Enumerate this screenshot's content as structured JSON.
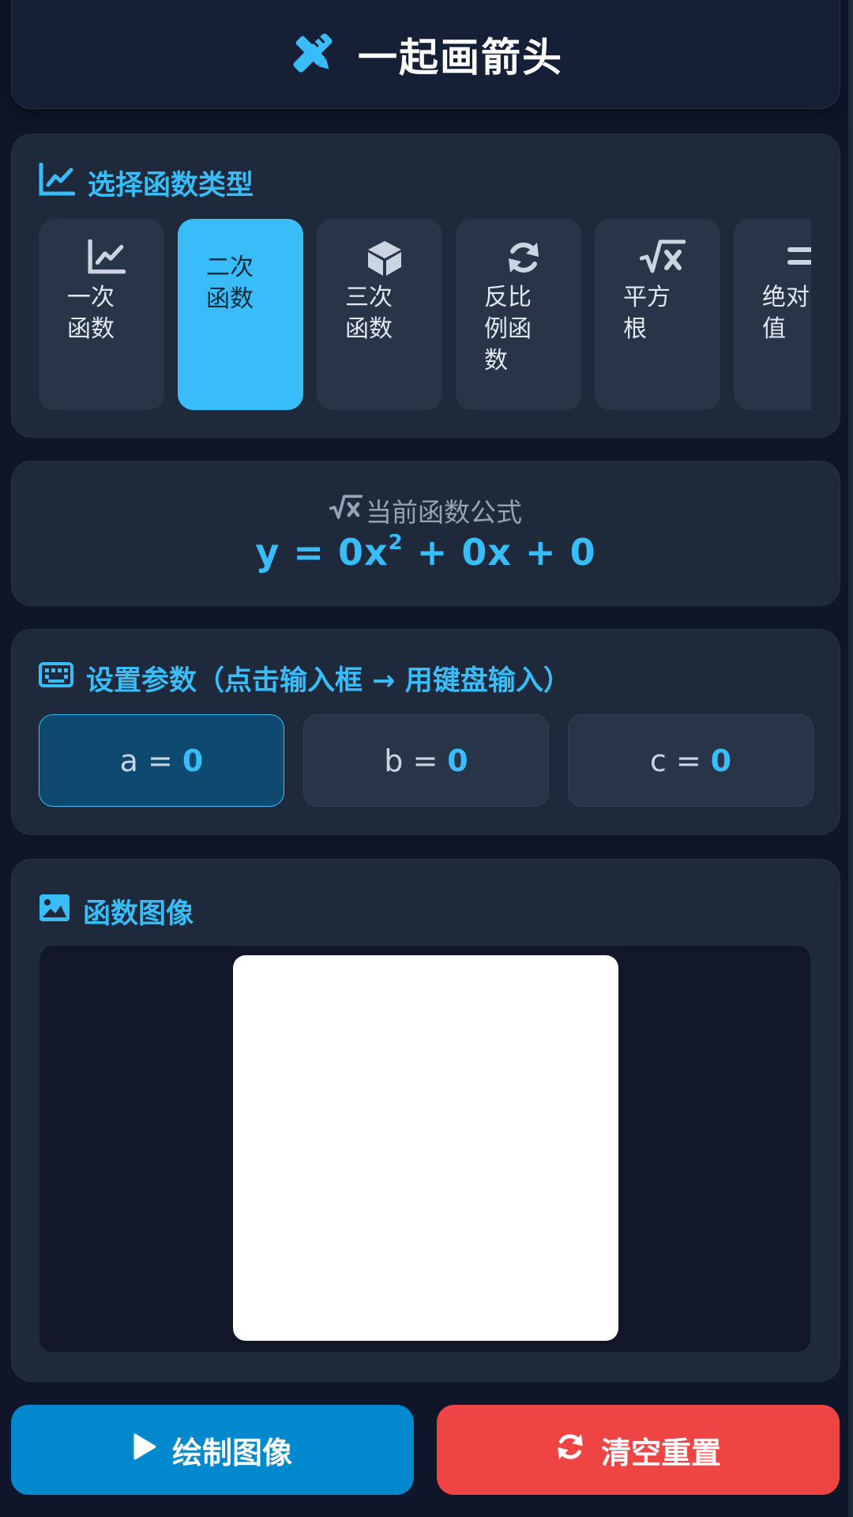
{
  "app": {
    "title": "一起画箭头"
  },
  "function_types": {
    "title": "选择函数类型",
    "selected": "二次函数",
    "items": [
      {
        "label": "一次函数",
        "icon": "line-chart-icon"
      },
      {
        "label": "二次函数",
        "icon": ""
      },
      {
        "label": "三次函数",
        "icon": "cube-icon"
      },
      {
        "label": "反比例函数",
        "icon": "refresh-icon"
      },
      {
        "label": "平方根",
        "icon": "square-root-icon"
      },
      {
        "label": "绝对值",
        "icon": "equals-icon"
      }
    ]
  },
  "formula": {
    "label": "当前函数公式",
    "prefix": "y = 0x",
    "exponent": "2",
    "suffix": " + 0x + 0"
  },
  "params": {
    "title": "设置参数（点击输入框 → 用键盘输入）",
    "items": [
      {
        "name": "a =",
        "value": "0"
      },
      {
        "name": "b =",
        "value": "0"
      },
      {
        "name": "c =",
        "value": "0"
      }
    ]
  },
  "graph": {
    "title": "函数图像"
  },
  "actions": {
    "draw_label": "绘制图像",
    "reset_label": "清空重置"
  },
  "colors": {
    "accent": "#38bdf8",
    "background": "#0f1629",
    "card": "#1e293b",
    "draw": "#0288cc",
    "reset": "#ef4444"
  }
}
